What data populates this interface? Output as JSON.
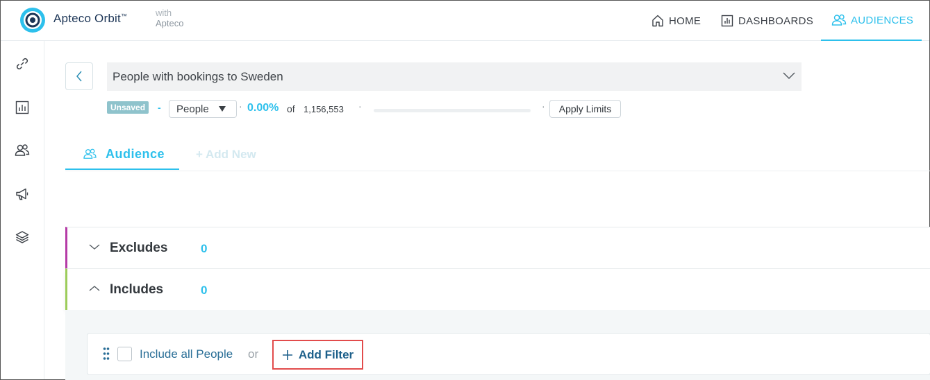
{
  "header": {
    "brand": "Apteco Orbit",
    "brand_mark": "™",
    "with_label": "with",
    "with_vendor": "Apteco",
    "nav": {
      "home": "HOME",
      "dashboards": "DASHBOARDS",
      "audiences": "AUDIENCES"
    },
    "accent_color": "#2dc0ec"
  },
  "sidebar": {
    "icons": [
      "link-icon",
      "dashboard-chart-icon",
      "people-icon",
      "megaphone-icon",
      "layers-icon"
    ]
  },
  "audience": {
    "title": "People with bookings to Sweden",
    "status_badge": "Unsaved",
    "separator": "-",
    "resolve_level": "People",
    "dot": "·",
    "percent": "0.00%",
    "of_label": "of",
    "total": "1,156,553",
    "progress_fraction": 0,
    "apply_limits": "Apply Limits"
  },
  "tabs": {
    "audience": "Audience",
    "add_new": "+ Add New"
  },
  "sections": {
    "excludes": {
      "label": "Excludes",
      "count": "0",
      "color": "#b53aa6"
    },
    "includes": {
      "label": "Includes",
      "count": "0",
      "color": "#9ccc5a"
    }
  },
  "filter_row": {
    "include_all": "Include all People",
    "or_label": "or",
    "add_filter": "Add Filter"
  }
}
